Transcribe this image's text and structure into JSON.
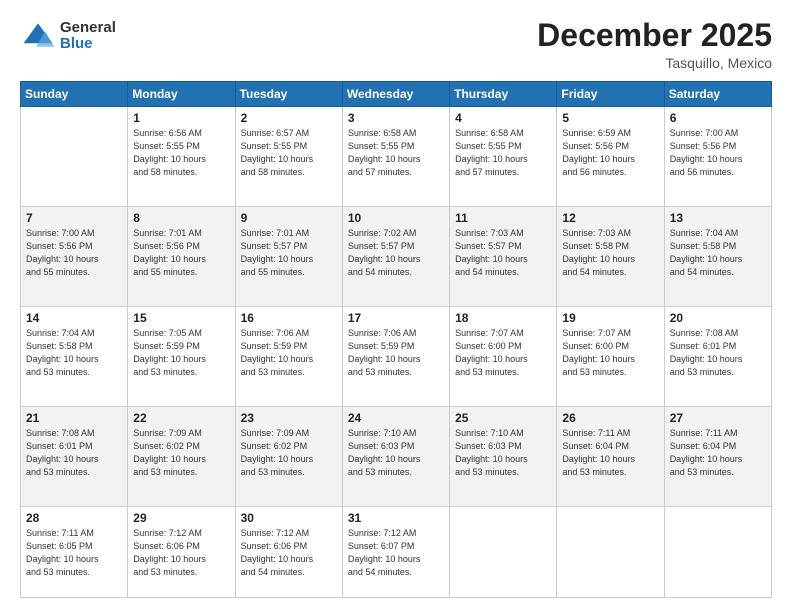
{
  "logo": {
    "general": "General",
    "blue": "Blue"
  },
  "header": {
    "month": "December 2025",
    "location": "Tasquillo, Mexico"
  },
  "weekdays": [
    "Sunday",
    "Monday",
    "Tuesday",
    "Wednesday",
    "Thursday",
    "Friday",
    "Saturday"
  ],
  "weeks": [
    [
      {
        "day": "",
        "info": ""
      },
      {
        "day": "1",
        "info": "Sunrise: 6:56 AM\nSunset: 5:55 PM\nDaylight: 10 hours\nand 58 minutes."
      },
      {
        "day": "2",
        "info": "Sunrise: 6:57 AM\nSunset: 5:55 PM\nDaylight: 10 hours\nand 58 minutes."
      },
      {
        "day": "3",
        "info": "Sunrise: 6:58 AM\nSunset: 5:55 PM\nDaylight: 10 hours\nand 57 minutes."
      },
      {
        "day": "4",
        "info": "Sunrise: 6:58 AM\nSunset: 5:55 PM\nDaylight: 10 hours\nand 57 minutes."
      },
      {
        "day": "5",
        "info": "Sunrise: 6:59 AM\nSunset: 5:56 PM\nDaylight: 10 hours\nand 56 minutes."
      },
      {
        "day": "6",
        "info": "Sunrise: 7:00 AM\nSunset: 5:56 PM\nDaylight: 10 hours\nand 56 minutes."
      }
    ],
    [
      {
        "day": "7",
        "info": "Sunrise: 7:00 AM\nSunset: 5:56 PM\nDaylight: 10 hours\nand 55 minutes."
      },
      {
        "day": "8",
        "info": "Sunrise: 7:01 AM\nSunset: 5:56 PM\nDaylight: 10 hours\nand 55 minutes."
      },
      {
        "day": "9",
        "info": "Sunrise: 7:01 AM\nSunset: 5:57 PM\nDaylight: 10 hours\nand 55 minutes."
      },
      {
        "day": "10",
        "info": "Sunrise: 7:02 AM\nSunset: 5:57 PM\nDaylight: 10 hours\nand 54 minutes."
      },
      {
        "day": "11",
        "info": "Sunrise: 7:03 AM\nSunset: 5:57 PM\nDaylight: 10 hours\nand 54 minutes."
      },
      {
        "day": "12",
        "info": "Sunrise: 7:03 AM\nSunset: 5:58 PM\nDaylight: 10 hours\nand 54 minutes."
      },
      {
        "day": "13",
        "info": "Sunrise: 7:04 AM\nSunset: 5:58 PM\nDaylight: 10 hours\nand 54 minutes."
      }
    ],
    [
      {
        "day": "14",
        "info": "Sunrise: 7:04 AM\nSunset: 5:58 PM\nDaylight: 10 hours\nand 53 minutes."
      },
      {
        "day": "15",
        "info": "Sunrise: 7:05 AM\nSunset: 5:59 PM\nDaylight: 10 hours\nand 53 minutes."
      },
      {
        "day": "16",
        "info": "Sunrise: 7:06 AM\nSunset: 5:59 PM\nDaylight: 10 hours\nand 53 minutes."
      },
      {
        "day": "17",
        "info": "Sunrise: 7:06 AM\nSunset: 5:59 PM\nDaylight: 10 hours\nand 53 minutes."
      },
      {
        "day": "18",
        "info": "Sunrise: 7:07 AM\nSunset: 6:00 PM\nDaylight: 10 hours\nand 53 minutes."
      },
      {
        "day": "19",
        "info": "Sunrise: 7:07 AM\nSunset: 6:00 PM\nDaylight: 10 hours\nand 53 minutes."
      },
      {
        "day": "20",
        "info": "Sunrise: 7:08 AM\nSunset: 6:01 PM\nDaylight: 10 hours\nand 53 minutes."
      }
    ],
    [
      {
        "day": "21",
        "info": "Sunrise: 7:08 AM\nSunset: 6:01 PM\nDaylight: 10 hours\nand 53 minutes."
      },
      {
        "day": "22",
        "info": "Sunrise: 7:09 AM\nSunset: 6:02 PM\nDaylight: 10 hours\nand 53 minutes."
      },
      {
        "day": "23",
        "info": "Sunrise: 7:09 AM\nSunset: 6:02 PM\nDaylight: 10 hours\nand 53 minutes."
      },
      {
        "day": "24",
        "info": "Sunrise: 7:10 AM\nSunset: 6:03 PM\nDaylight: 10 hours\nand 53 minutes."
      },
      {
        "day": "25",
        "info": "Sunrise: 7:10 AM\nSunset: 6:03 PM\nDaylight: 10 hours\nand 53 minutes."
      },
      {
        "day": "26",
        "info": "Sunrise: 7:11 AM\nSunset: 6:04 PM\nDaylight: 10 hours\nand 53 minutes."
      },
      {
        "day": "27",
        "info": "Sunrise: 7:11 AM\nSunset: 6:04 PM\nDaylight: 10 hours\nand 53 minutes."
      }
    ],
    [
      {
        "day": "28",
        "info": "Sunrise: 7:11 AM\nSunset: 6:05 PM\nDaylight: 10 hours\nand 53 minutes."
      },
      {
        "day": "29",
        "info": "Sunrise: 7:12 AM\nSunset: 6:06 PM\nDaylight: 10 hours\nand 53 minutes."
      },
      {
        "day": "30",
        "info": "Sunrise: 7:12 AM\nSunset: 6:06 PM\nDaylight: 10 hours\nand 54 minutes."
      },
      {
        "day": "31",
        "info": "Sunrise: 7:12 AM\nSunset: 6:07 PM\nDaylight: 10 hours\nand 54 minutes."
      },
      {
        "day": "",
        "info": ""
      },
      {
        "day": "",
        "info": ""
      },
      {
        "day": "",
        "info": ""
      }
    ]
  ]
}
